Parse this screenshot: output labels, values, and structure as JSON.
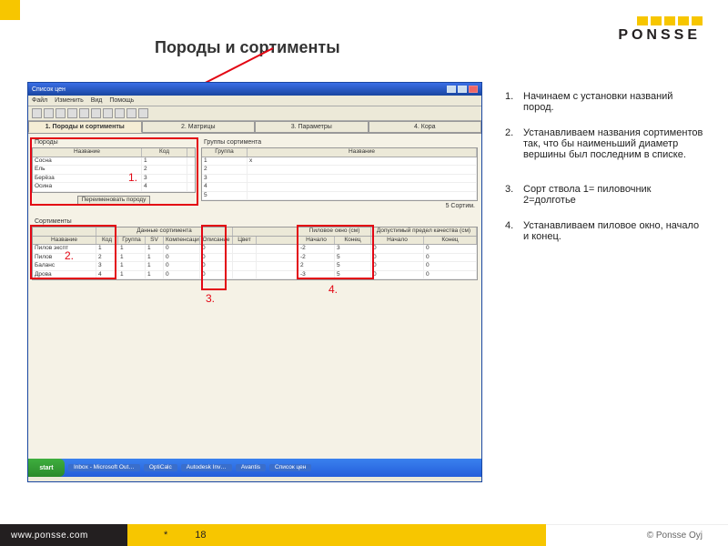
{
  "brand": {
    "name": "PONSSE",
    "squares": 5
  },
  "slide": {
    "title": "Породы и сортименты",
    "callouts": {
      "c1": "1.",
      "c2": "2.",
      "c3": "3.",
      "c4": "4."
    }
  },
  "window": {
    "title": "Список цен",
    "menus": [
      "Файл",
      "Изменить",
      "Вид",
      "Помощь"
    ],
    "tabs": {
      "t1": "1. Породы и сортименты",
      "t2": "2. Матрицы",
      "t3": "3. Параметры",
      "t4": "4. Кора"
    },
    "species_panel": {
      "label": "Породы",
      "columns": {
        "name": "Название",
        "code": "Код"
      },
      "rows": [
        {
          "name": "Сосна",
          "code": "1"
        },
        {
          "name": "Ель",
          "code": "2"
        },
        {
          "name": "Берёза",
          "code": "3"
        },
        {
          "name": "Осина",
          "code": "4"
        }
      ],
      "rename_button": "Переименовать породу"
    },
    "groups_panel": {
      "label": "Группы сортимента",
      "columns": {
        "group": "Группа",
        "name": "Название"
      },
      "rows": [
        {
          "group": "1",
          "name": "x"
        },
        {
          "group": "2",
          "name": ""
        },
        {
          "group": "3",
          "name": ""
        },
        {
          "group": "4",
          "name": ""
        },
        {
          "group": "5",
          "name": ""
        }
      ],
      "footer": "5 Сортим."
    },
    "assort_panel": {
      "label": "Сортименты",
      "section_data": "Данные сортимента",
      "section_saw": "Пиловое окно (см)",
      "section_allow": "Допустимый предел качества (см)",
      "columns": {
        "name": "Название",
        "code": "Код",
        "group": "Группа",
        "sv": "SV",
        "comp": "Компенсаци",
        "desc": "Описание",
        "color": "Цвет",
        "start": "Начало",
        "end": "Конец",
        "astart": "Начало",
        "aend": "Конец"
      },
      "rows": [
        {
          "name": "Пилов экспт",
          "code": "1",
          "group": "1",
          "sv": "1",
          "comp": "0",
          "desc": "0",
          "color": "",
          "start": "-2",
          "end": "3",
          "astart": "0",
          "aend": "0"
        },
        {
          "name": "Пилов",
          "code": "2",
          "group": "1",
          "sv": "1",
          "comp": "0",
          "desc": "0",
          "color": "",
          "start": "-2",
          "end": "5",
          "astart": "0",
          "aend": "0"
        },
        {
          "name": "Баланс",
          "code": "3",
          "group": "1",
          "sv": "1",
          "comp": "0",
          "desc": "0",
          "color": "",
          "start": "2",
          "end": "5",
          "astart": "0",
          "aend": "0"
        },
        {
          "name": "Дрова",
          "code": "4",
          "group": "1",
          "sv": "1",
          "comp": "0",
          "desc": "0",
          "color": "",
          "start": "-3",
          "end": "5",
          "astart": "0",
          "aend": "0"
        }
      ]
    },
    "taskbar": {
      "start": "start",
      "items": [
        "Inbox - Microsoft Out…",
        "OptiCalc",
        "",
        "Autodesk Inv…",
        "Avantis",
        "Список цен"
      ]
    }
  },
  "notes": {
    "n1": "Начинаем с установки названий пород.",
    "n2": "Устанавливаем названия сортиментов так, что бы наименьший диаметр вершины был последним в списке.",
    "n3": "Сорт ствола 1= пиловочник 2=долготье",
    "n4": "Устанавливаем пиловое окно, начало и конец."
  },
  "footer": {
    "url": "www.ponsse.com",
    "star": "*",
    "page": "18",
    "copyright": "© Ponsse Oyj"
  }
}
